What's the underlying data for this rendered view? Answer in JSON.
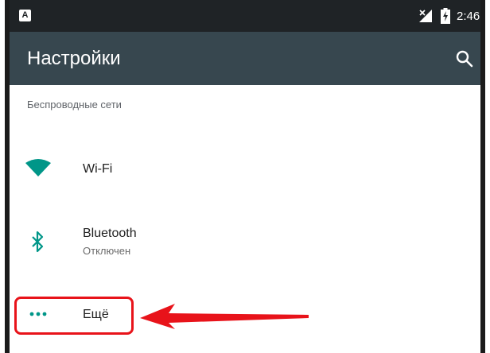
{
  "status_bar": {
    "notification_icon": "a-notification-icon",
    "notification_glyph": "A",
    "signal_icon": "no-signal-icon",
    "battery_icon": "battery-charging-icon",
    "time": "2:46"
  },
  "toolbar": {
    "title": "Настройки",
    "search_icon": "search-icon"
  },
  "section": {
    "header": "Беспроводные сети"
  },
  "items": [
    {
      "icon": "wifi-icon",
      "title": "Wi-Fi",
      "subtitle": ""
    },
    {
      "icon": "bluetooth-icon",
      "title": "Bluetooth",
      "subtitle": "Отключен"
    },
    {
      "icon": "more-dots-icon",
      "title": "Ещё",
      "subtitle": ""
    }
  ],
  "annotation": {
    "highlight_color": "#e8131a",
    "arrow_icon": "red-arrow-left-icon"
  },
  "colors": {
    "status_bar": "#1f2326",
    "toolbar": "#37474f",
    "accent": "#009688"
  }
}
